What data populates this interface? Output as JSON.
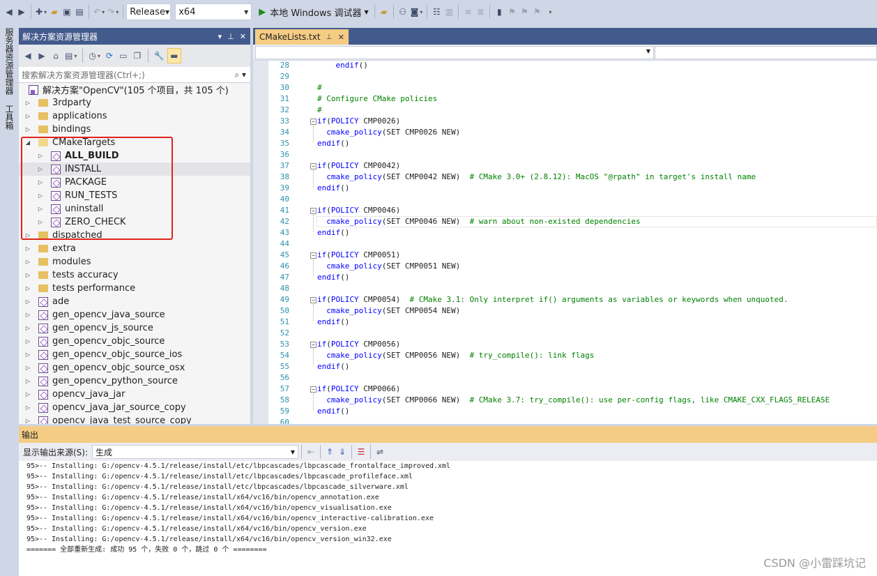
{
  "toolbar": {
    "config": "Release",
    "platform": "x64",
    "run_label": "本地 Windows 调试器"
  },
  "side_tabs": [
    "服务器资源管理器",
    "工具箱"
  ],
  "solution_explorer": {
    "title": "解决方案资源管理器",
    "search_placeholder": "搜索解决方案资源管理器(Ctrl+;)",
    "solution_label": "解决方案\"OpenCV\"(105 个项目，共 105 个)",
    "nodes": [
      {
        "label": "3rdparty",
        "kind": "folder",
        "level": 1
      },
      {
        "label": "applications",
        "kind": "folder",
        "level": 1
      },
      {
        "label": "bindings",
        "kind": "folder",
        "level": 1
      },
      {
        "label": "CMakeTargets",
        "kind": "folder-open",
        "level": 1
      },
      {
        "label": "ALL_BUILD",
        "kind": "project",
        "level": 2,
        "bold": true
      },
      {
        "label": "INSTALL",
        "kind": "project",
        "level": 2,
        "selected": true
      },
      {
        "label": "PACKAGE",
        "kind": "project",
        "level": 2
      },
      {
        "label": "RUN_TESTS",
        "kind": "project",
        "level": 2
      },
      {
        "label": "uninstall",
        "kind": "project",
        "level": 2
      },
      {
        "label": "ZERO_CHECK",
        "kind": "project",
        "level": 2
      },
      {
        "label": "dispatched",
        "kind": "folder",
        "level": 1
      },
      {
        "label": "extra",
        "kind": "folder",
        "level": 1
      },
      {
        "label": "modules",
        "kind": "folder",
        "level": 1
      },
      {
        "label": "tests accuracy",
        "kind": "folder",
        "level": 1
      },
      {
        "label": "tests performance",
        "kind": "folder",
        "level": 1
      },
      {
        "label": "ade",
        "kind": "project",
        "level": 1
      },
      {
        "label": "gen_opencv_java_source",
        "kind": "project",
        "level": 1
      },
      {
        "label": "gen_opencv_js_source",
        "kind": "project",
        "level": 1
      },
      {
        "label": "gen_opencv_objc_source",
        "kind": "project",
        "level": 1
      },
      {
        "label": "gen_opencv_objc_source_ios",
        "kind": "project",
        "level": 1
      },
      {
        "label": "gen_opencv_objc_source_osx",
        "kind": "project",
        "level": 1
      },
      {
        "label": "gen_opencv_python_source",
        "kind": "project",
        "level": 1
      },
      {
        "label": "opencv_java_jar",
        "kind": "project",
        "level": 1
      },
      {
        "label": "opencv_java_jar_source_copy",
        "kind": "project",
        "level": 1
      },
      {
        "label": "opencv_java_test_source_copy",
        "kind": "project",
        "level": 1
      }
    ]
  },
  "editor": {
    "tab_label": "CMakeLists.txt",
    "lines": [
      {
        "n": "28",
        "parts": [
          [
            "    ",
            "p"
          ],
          [
            "endif",
            "kw"
          ],
          [
            "()",
            "p"
          ]
        ]
      },
      {
        "n": "29",
        "parts": []
      },
      {
        "n": "30",
        "parts": [
          [
            "#",
            "cm"
          ]
        ]
      },
      {
        "n": "31",
        "parts": [
          [
            "# Configure CMake policies",
            "cm"
          ]
        ]
      },
      {
        "n": "32",
        "parts": [
          [
            "#",
            "cm"
          ]
        ]
      },
      {
        "n": "33",
        "fold": true,
        "parts": [
          [
            "if",
            "kw"
          ],
          [
            "(",
            "p"
          ],
          [
            "POLICY",
            "kw"
          ],
          [
            " CMP0026)",
            "p"
          ]
        ]
      },
      {
        "n": "34",
        "parts": [
          [
            "  cmake_policy",
            "kw"
          ],
          [
            "(SET CMP0026 NEW)",
            "p"
          ]
        ]
      },
      {
        "n": "35",
        "parts": [
          [
            "endif",
            "kw"
          ],
          [
            "()",
            "p"
          ]
        ]
      },
      {
        "n": "36",
        "parts": []
      },
      {
        "n": "37",
        "fold": true,
        "parts": [
          [
            "if",
            "kw"
          ],
          [
            "(",
            "p"
          ],
          [
            "POLICY",
            "kw"
          ],
          [
            " CMP0042)",
            "p"
          ]
        ]
      },
      {
        "n": "38",
        "parts": [
          [
            "  cmake_policy",
            "kw"
          ],
          [
            "(SET CMP0042 NEW)  ",
            "p"
          ],
          [
            "# CMake 3.0+ (2.8.12): MacOS \"@rpath\" in target's install name",
            "cm"
          ]
        ]
      },
      {
        "n": "39",
        "parts": [
          [
            "endif",
            "kw"
          ],
          [
            "()",
            "p"
          ]
        ]
      },
      {
        "n": "40",
        "parts": []
      },
      {
        "n": "41",
        "fold": true,
        "parts": [
          [
            "if",
            "kw"
          ],
          [
            "(",
            "p"
          ],
          [
            "POLICY",
            "kw"
          ],
          [
            " CMP0046)",
            "p"
          ]
        ]
      },
      {
        "n": "42",
        "current": true,
        "parts": [
          [
            "  cmake_policy",
            "kw"
          ],
          [
            "(SET CMP0046 NEW)  ",
            "p"
          ],
          [
            "# warn about non-existed dependencies",
            "cm"
          ]
        ]
      },
      {
        "n": "43",
        "parts": [
          [
            "endif",
            "kw"
          ],
          [
            "()",
            "p"
          ]
        ]
      },
      {
        "n": "44",
        "parts": []
      },
      {
        "n": "45",
        "fold": true,
        "parts": [
          [
            "if",
            "kw"
          ],
          [
            "(",
            "p"
          ],
          [
            "POLICY",
            "kw"
          ],
          [
            " CMP0051)",
            "p"
          ]
        ]
      },
      {
        "n": "46",
        "parts": [
          [
            "  cmake_policy",
            "kw"
          ],
          [
            "(SET CMP0051 NEW)",
            "p"
          ]
        ]
      },
      {
        "n": "47",
        "parts": [
          [
            "endif",
            "kw"
          ],
          [
            "()",
            "p"
          ]
        ]
      },
      {
        "n": "48",
        "parts": []
      },
      {
        "n": "49",
        "fold": true,
        "parts": [
          [
            "if",
            "kw"
          ],
          [
            "(",
            "p"
          ],
          [
            "POLICY",
            "kw"
          ],
          [
            " CMP0054)  ",
            "p"
          ],
          [
            "# CMake 3.1: Only interpret if() arguments as variables or keywords when unquoted.",
            "cm"
          ]
        ]
      },
      {
        "n": "50",
        "parts": [
          [
            "  cmake_policy",
            "kw"
          ],
          [
            "(SET CMP0054 NEW)",
            "p"
          ]
        ]
      },
      {
        "n": "51",
        "parts": [
          [
            "endif",
            "kw"
          ],
          [
            "()",
            "p"
          ]
        ]
      },
      {
        "n": "52",
        "parts": []
      },
      {
        "n": "53",
        "fold": true,
        "parts": [
          [
            "if",
            "kw"
          ],
          [
            "(",
            "p"
          ],
          [
            "POLICY",
            "kw"
          ],
          [
            " CMP0056)",
            "p"
          ]
        ]
      },
      {
        "n": "54",
        "parts": [
          [
            "  cmake_policy",
            "kw"
          ],
          [
            "(SET CMP0056 NEW)  ",
            "p"
          ],
          [
            "# try_compile(): link flags",
            "cm"
          ]
        ]
      },
      {
        "n": "55",
        "parts": [
          [
            "endif",
            "kw"
          ],
          [
            "()",
            "p"
          ]
        ]
      },
      {
        "n": "56",
        "parts": []
      },
      {
        "n": "57",
        "fold": true,
        "parts": [
          [
            "if",
            "kw"
          ],
          [
            "(",
            "p"
          ],
          [
            "POLICY",
            "kw"
          ],
          [
            " CMP0066)",
            "p"
          ]
        ]
      },
      {
        "n": "58",
        "parts": [
          [
            "  cmake_policy",
            "kw"
          ],
          [
            "(SET CMP0066 NEW)  ",
            "p"
          ],
          [
            "# CMake 3.7: try_compile(): use per-config flags, like CMAKE_CXX_FLAGS_RELEASE",
            "cm"
          ]
        ]
      },
      {
        "n": "59",
        "parts": [
          [
            "endif",
            "kw"
          ],
          [
            "()",
            "p"
          ]
        ]
      },
      {
        "n": "60",
        "parts": []
      }
    ]
  },
  "output": {
    "title": "输出",
    "source_label": "显示输出来源(S):",
    "source_value": "生成",
    "lines": [
      "95>-- Installing: G:/opencv-4.5.1/release/install/etc/lbpcascades/lbpcascade_frontalface_improved.xml",
      "95>-- Installing: G:/opencv-4.5.1/release/install/etc/lbpcascades/lbpcascade_profileface.xml",
      "95>-- Installing: G:/opencv-4.5.1/release/install/etc/lbpcascades/lbpcascade_silverware.xml",
      "95>-- Installing: G:/opencv-4.5.1/release/install/x64/vc16/bin/opencv_annotation.exe",
      "95>-- Installing: G:/opencv-4.5.1/release/install/x64/vc16/bin/opencv_visualisation.exe",
      "95>-- Installing: G:/opencv-4.5.1/release/install/x64/vc16/bin/opencv_interactive-calibration.exe",
      "95>-- Installing: G:/opencv-4.5.1/release/install/x64/vc16/bin/opencv_version.exe",
      "95>-- Installing: G:/opencv-4.5.1/release/install/x64/vc16/bin/opencv_version_win32.exe",
      "======= 全部重新生成: 成功 95 个，失败 0 个，跳过 0 个 ========"
    ]
  },
  "watermark": "CSDN @小雷踩坑记"
}
